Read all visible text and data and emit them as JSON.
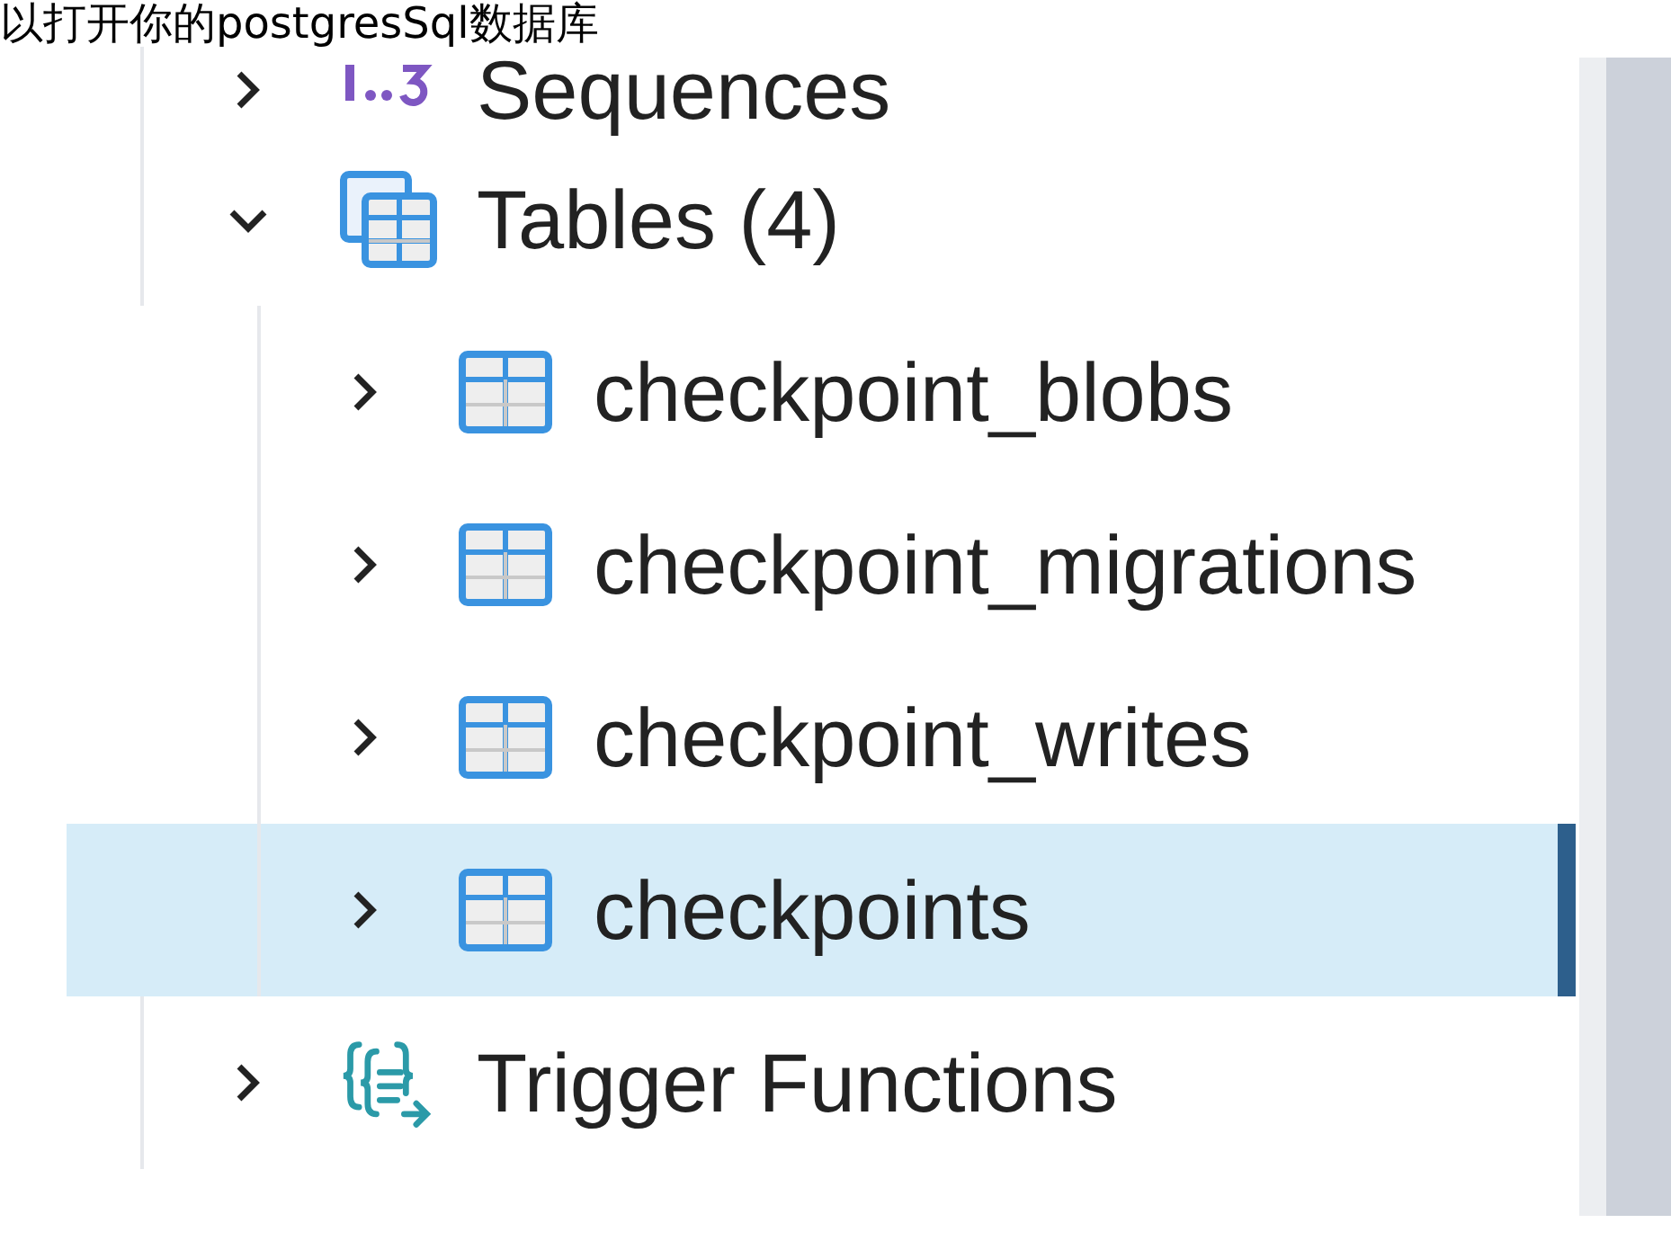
{
  "caption": "以打开你的postgresSql数据库",
  "tree": [
    {
      "label": "Sequences",
      "kind": "sequence",
      "expanded": false,
      "selected": false
    },
    {
      "label": "Tables (4)",
      "kind": "tables",
      "expanded": true,
      "selected": false,
      "children": [
        {
          "label": "checkpoint_blobs",
          "kind": "table",
          "expanded": false,
          "selected": false
        },
        {
          "label": "checkpoint_migrations",
          "kind": "table",
          "expanded": false,
          "selected": false
        },
        {
          "label": "checkpoint_writes",
          "kind": "table",
          "expanded": false,
          "selected": false
        },
        {
          "label": "checkpoints",
          "kind": "table",
          "expanded": false,
          "selected": true
        }
      ]
    },
    {
      "label": "Trigger Functions",
      "kind": "trigger",
      "expanded": false,
      "selected": false
    }
  ]
}
